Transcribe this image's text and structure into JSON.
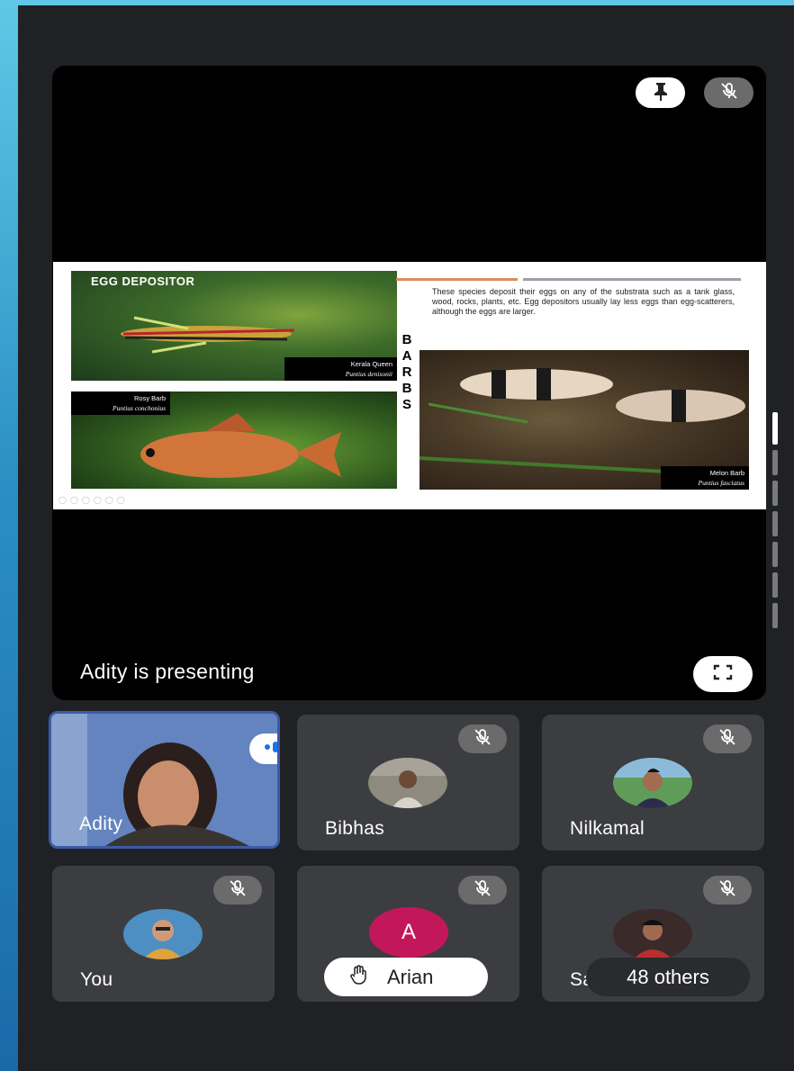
{
  "stage": {
    "presenting_label": "Adity is presenting"
  },
  "slide": {
    "title": "EGG DEPOSITOR",
    "vertical_word": [
      "B",
      "A",
      "R",
      "B",
      "S"
    ],
    "body": "These species deposit their eggs on any of the substrata such as a tank glass, wood, rocks, plants, etc. Egg depositors usually lay less eggs than egg-scatterers, although the eggs are larger.",
    "photos": [
      {
        "common": "Kerala Queen",
        "scientific": "Puntius denisonii"
      },
      {
        "common": "Rosy Barb",
        "scientific": "Puntius conchonius"
      },
      {
        "common": "Melon Barb",
        "scientific": "Puntius fasciatus"
      }
    ]
  },
  "participants": [
    {
      "name": "Adity",
      "state": "speaking"
    },
    {
      "name": "Bibhas",
      "state": "muted"
    },
    {
      "name": "Nilkamal",
      "state": "muted"
    },
    {
      "name": "You",
      "state": "muted"
    },
    {
      "name": "Arian",
      "state": "muted",
      "avatar_letter": "A"
    },
    {
      "name": "Sa",
      "state": "muted"
    }
  ],
  "hand_raise": {
    "name": "Arian"
  },
  "others_chip": {
    "label": "48 others"
  },
  "colors": {
    "background": "#202124",
    "tile": "#3c3d40",
    "active_border": "#3b5ba9",
    "letter_avatar": "#c2185b"
  },
  "icons": [
    "pin-icon",
    "mic-off-icon",
    "fullscreen-icon",
    "speaking-indicator-icon",
    "raise-hand-icon"
  ]
}
